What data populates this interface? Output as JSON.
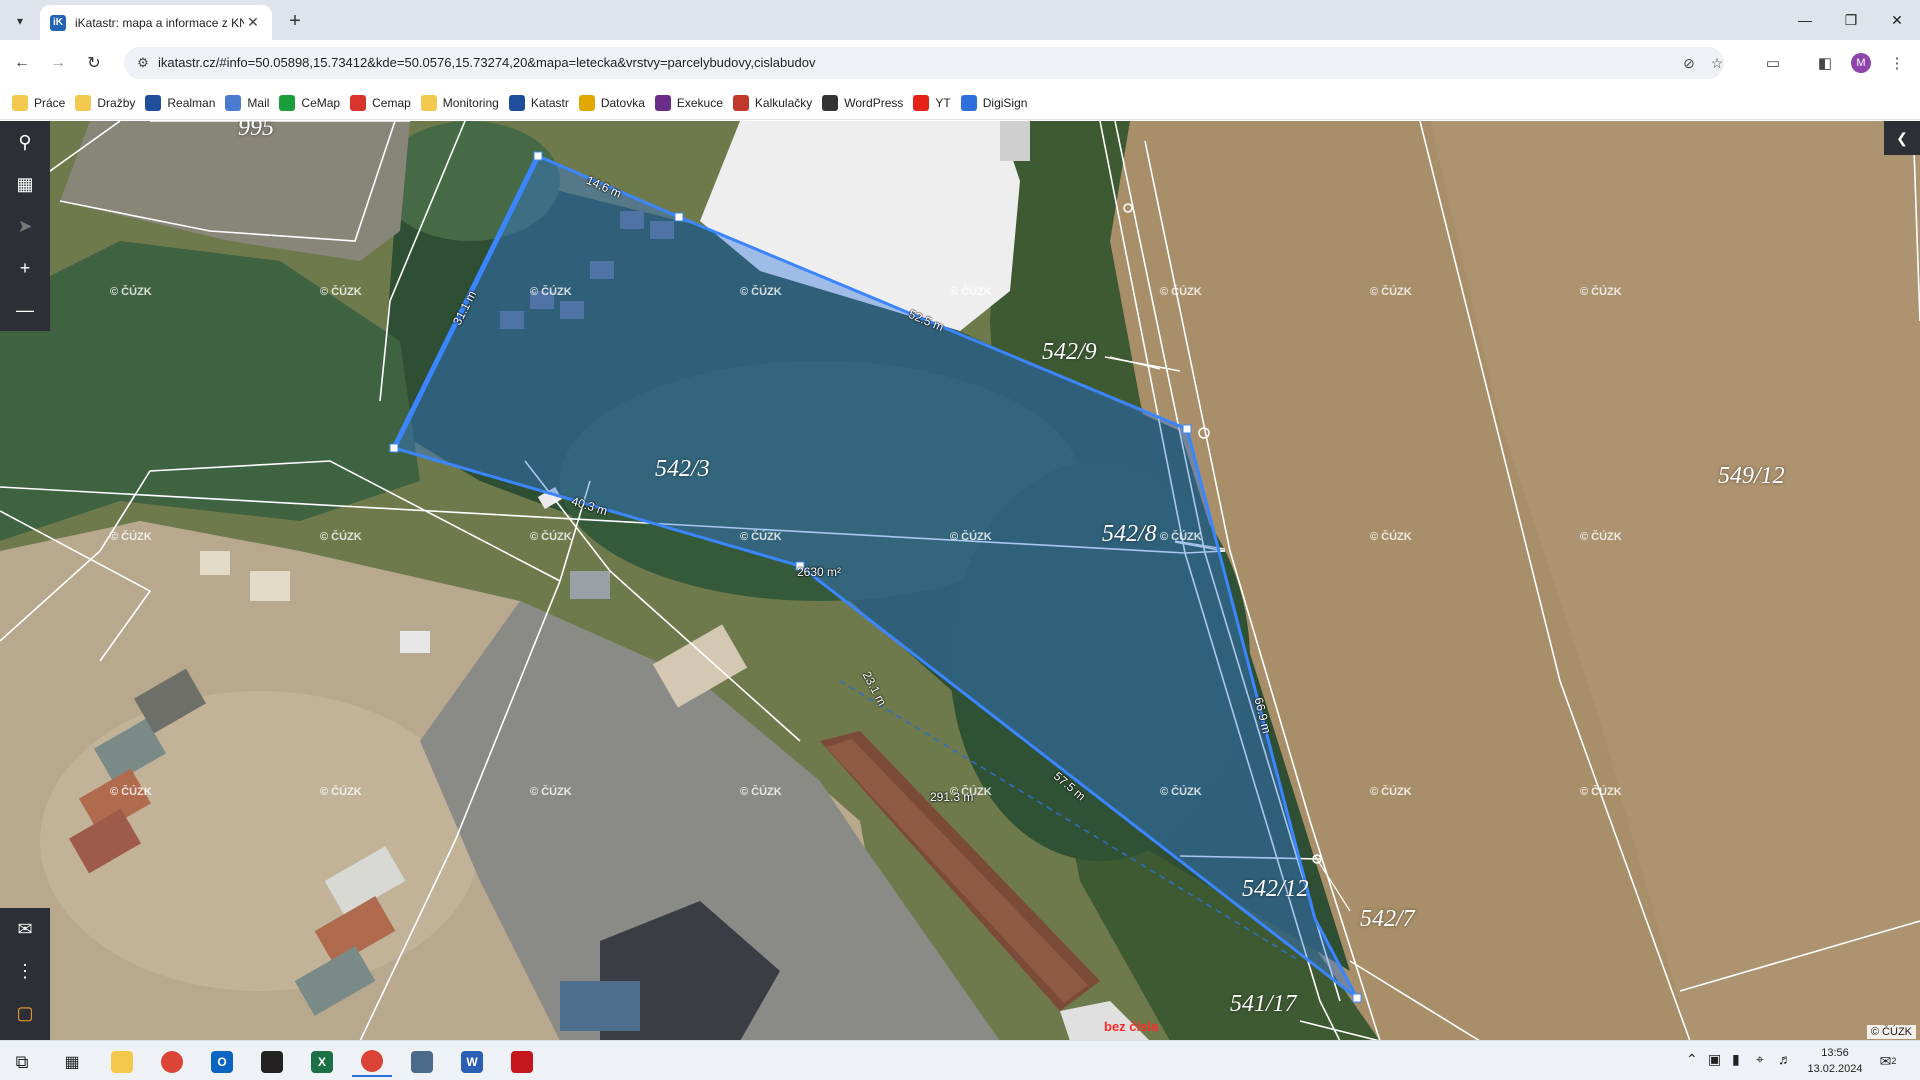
{
  "browser": {
    "tab": {
      "title": "iKatastr: mapa a informace z KN",
      "favicon": "iK"
    },
    "address": {
      "url": "ikatastr.cz/#info=50.05898,15.73412&kde=50.0576,15.73274,20&mapa=letecka&vrstvy=parcelybudovy,cislabudov"
    },
    "profile_initial": "M",
    "bookmarks": [
      {
        "label": "Práce",
        "icon": "folder-icon",
        "color": "#f2c94c"
      },
      {
        "label": "Dražby",
        "icon": "folder-icon",
        "color": "#f2c94c"
      },
      {
        "label": "Realman",
        "icon": "realman-icon",
        "color": "#1f4e9c"
      },
      {
        "label": "Mail",
        "icon": "mail-icon",
        "color": "#4a7bd0"
      },
      {
        "label": "CeMap",
        "icon": "cemap-icon",
        "color": "#1a9e3b"
      },
      {
        "label": "Cemap",
        "icon": "pin-icon",
        "color": "#d9342b"
      },
      {
        "label": "Monitoring",
        "icon": "folder-icon",
        "color": "#f2c94c"
      },
      {
        "label": "Katastr",
        "icon": "katastr-icon",
        "color": "#1f4e9c"
      },
      {
        "label": "Datovka",
        "icon": "datovka-icon",
        "color": "#e0a800"
      },
      {
        "label": "Exekuce",
        "icon": "exekuce-icon",
        "color": "#6b2d8a"
      },
      {
        "label": "Kalkulačky",
        "icon": "calculator-icon",
        "color": "#c0392b"
      },
      {
        "label": "WordPress",
        "icon": "wordpress-icon",
        "color": "#333333"
      },
      {
        "label": "YT",
        "icon": "youtube-icon",
        "color": "#e62117"
      },
      {
        "label": "DigiSign",
        "icon": "digisign-icon",
        "color": "#2d6fdb"
      }
    ]
  },
  "map": {
    "parcels": [
      "995",
      "542/9",
      "542/3",
      "542/8",
      "549/12",
      "542/12",
      "542/7",
      "541/17"
    ],
    "measurements": {
      "top": "14.6 m",
      "left": "31.1 m",
      "upper_right": "52.5 m",
      "bottom_left": "40.3 m",
      "area": "2630 m²",
      "diag": "23.1 m",
      "lower_right": "57.5 m",
      "right_side": "66.9 m",
      "total": "291.3 m"
    },
    "watermark": "© ČÚZK",
    "copyright": "© ČÚZK",
    "red_label": "bez čísla"
  },
  "taskbar": {
    "time": "13:56",
    "date": "13.02.2024",
    "notifications": "2"
  }
}
